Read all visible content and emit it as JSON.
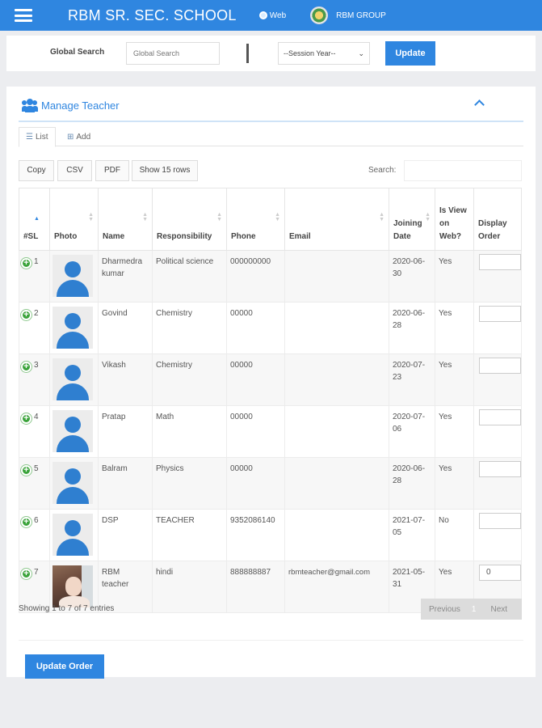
{
  "header": {
    "brand": "RBM SR. SEC. SCHOOL",
    "web_label": "Web",
    "group_label": "RBM GROUP"
  },
  "search": {
    "label": "Global Search",
    "placeholder": "Global Search",
    "session_value": "--Session Year--",
    "update_label": "Update"
  },
  "card": {
    "title": "Manage Teacher",
    "tabs": [
      {
        "label": "List",
        "active": true
      },
      {
        "label": "Add",
        "active": false
      }
    ],
    "tools": [
      "Copy",
      "CSV",
      "PDF",
      "Show 15 rows"
    ],
    "search_label": "Search:"
  },
  "table": {
    "headers": [
      "#SL",
      "Photo",
      "Name",
      "Responsibility",
      "Phone",
      "Email",
      "Joining Date",
      "Is View on Web?",
      "Display Order"
    ],
    "rows": [
      {
        "sl": "1",
        "photo": "avatar-placeholder",
        "name": "Dharmedra kumar",
        "responsibility": "Political science",
        "phone": "000000000",
        "email": "",
        "joining": "2020-06-30",
        "view": "Yes",
        "order": ""
      },
      {
        "sl": "2",
        "photo": "avatar-placeholder",
        "name": "Govind",
        "responsibility": "Chemistry",
        "phone": "00000",
        "email": "",
        "joining": "2020-06-28",
        "view": "Yes",
        "order": ""
      },
      {
        "sl": "3",
        "photo": "avatar-placeholder",
        "name": "Vikash",
        "responsibility": "Chemistry",
        "phone": "00000",
        "email": "",
        "joining": "2020-07-23",
        "view": "Yes",
        "order": ""
      },
      {
        "sl": "4",
        "photo": "avatar-placeholder",
        "name": "Pratap",
        "responsibility": "Math",
        "phone": "00000",
        "email": "",
        "joining": "2020-07-06",
        "view": "Yes",
        "order": ""
      },
      {
        "sl": "5",
        "photo": "avatar-placeholder",
        "name": "Balram",
        "responsibility": "Physics",
        "phone": "00000",
        "email": "",
        "joining": "2020-06-28",
        "view": "Yes",
        "order": ""
      },
      {
        "sl": "6",
        "photo": "avatar-placeholder",
        "name": "DSP",
        "responsibility": "TEACHER",
        "phone": "9352086140",
        "email": "",
        "joining": "2021-07-05",
        "view": "No",
        "order": ""
      },
      {
        "sl": "7",
        "photo": "photo",
        "name": "RBM teacher",
        "responsibility": "hindi",
        "phone": "888888887",
        "email": "rbmteacher@gmail.com",
        "joining": "2021-05-31",
        "view": "Yes",
        "order": "0"
      }
    ]
  },
  "footer": {
    "showing": "Showing 1 to 7 of 7 entries",
    "previous": "Previous",
    "current_page": "1",
    "next": "Next",
    "update_order_label": "Update Order"
  },
  "colors": {
    "primary": "#2f86e0",
    "expand_icon": "#3aa33a",
    "page_bg": "#ecedf0"
  },
  "icons": [
    "menu-icon",
    "globe-icon",
    "group-logo",
    "users-icon",
    "chevron-up-icon",
    "list-icon",
    "add-icon",
    "sort-icon",
    "expand-row-icon",
    "avatar-placeholder-icon"
  ]
}
